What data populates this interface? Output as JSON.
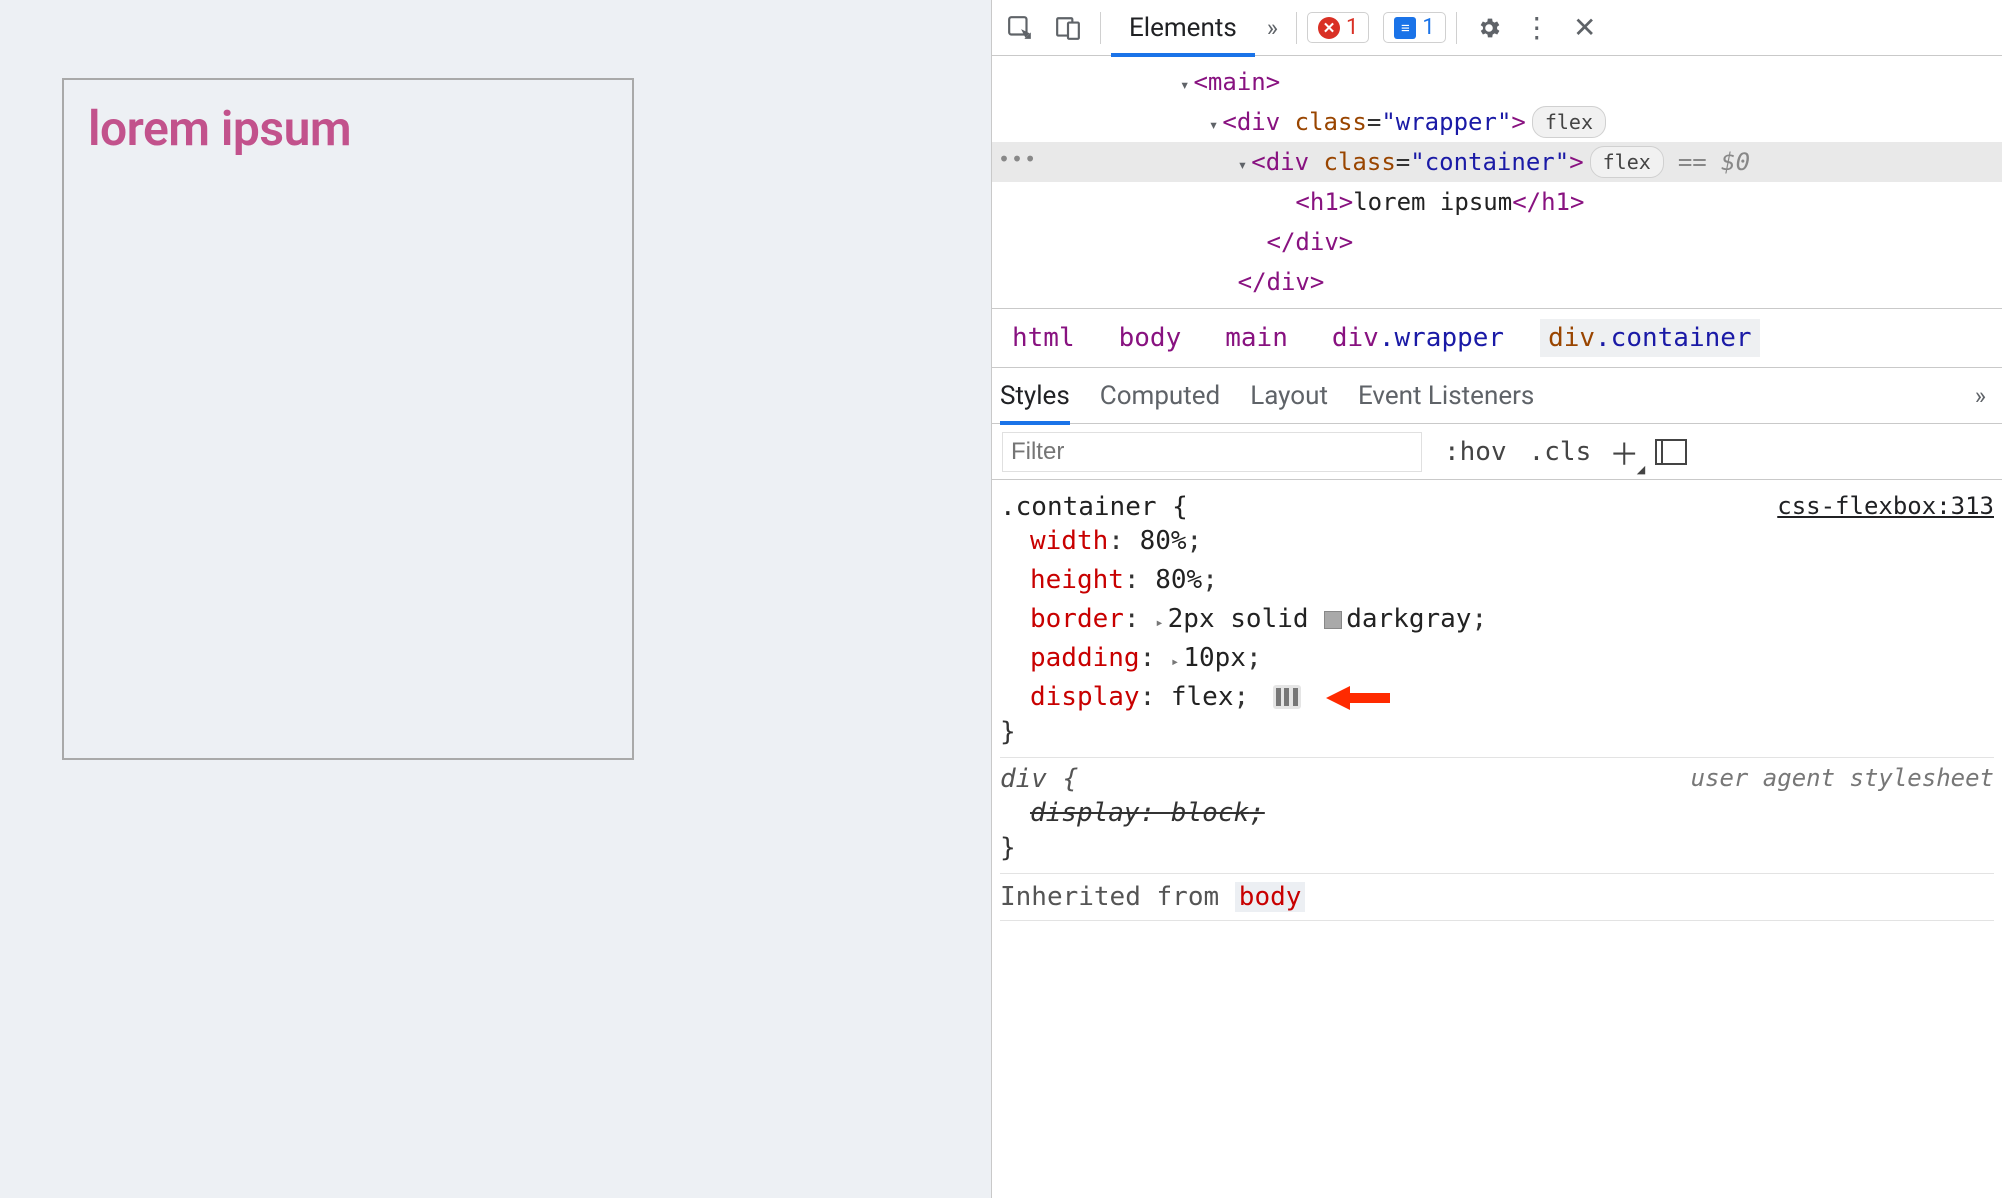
{
  "page": {
    "heading": "lorem ipsum"
  },
  "tabbar": {
    "active_tab": "Elements",
    "overflow_glyph": "»",
    "errors_count": "1",
    "messages_count": "1"
  },
  "dom": {
    "line1": "<main>",
    "line2_tag": "div",
    "line2_class_attr": "class",
    "line2_class_val": "wrapper",
    "line2_badge": "flex",
    "sel_tag": "div",
    "sel_class_val": "container",
    "sel_badge": "flex",
    "sel_eq": "== $0",
    "h1_tag": "h1",
    "h1_text": "lorem ipsum",
    "close_container": "</div>",
    "close_wrapper": "</div>"
  },
  "crumbs": [
    "html",
    "body",
    "main",
    "div.wrapper",
    "div.container"
  ],
  "subtabs": [
    "Styles",
    "Computed",
    "Layout",
    "Event Listeners"
  ],
  "filter": {
    "placeholder": "Filter",
    "hov": ":hov",
    "cls": ".cls"
  },
  "rule_container": {
    "selector": ".container {",
    "source": "css-flexbox:313",
    "decls": [
      {
        "name": "width",
        "value": "80%",
        "shorthand": false
      },
      {
        "name": "height",
        "value": "80%",
        "shorthand": false
      },
      {
        "name": "border",
        "value": "2px solid darkgray",
        "shorthand": true,
        "swatch": true
      },
      {
        "name": "padding",
        "value": "10px",
        "shorthand": true
      },
      {
        "name": "display",
        "value": "flex",
        "flexicon": true
      }
    ],
    "close": "}"
  },
  "rule_div": {
    "selector": "div {",
    "ua_label": "user agent stylesheet",
    "decl_name": "display",
    "decl_value": "block",
    "close": "}"
  },
  "inherited": {
    "label": "Inherited from",
    "from": "body"
  }
}
